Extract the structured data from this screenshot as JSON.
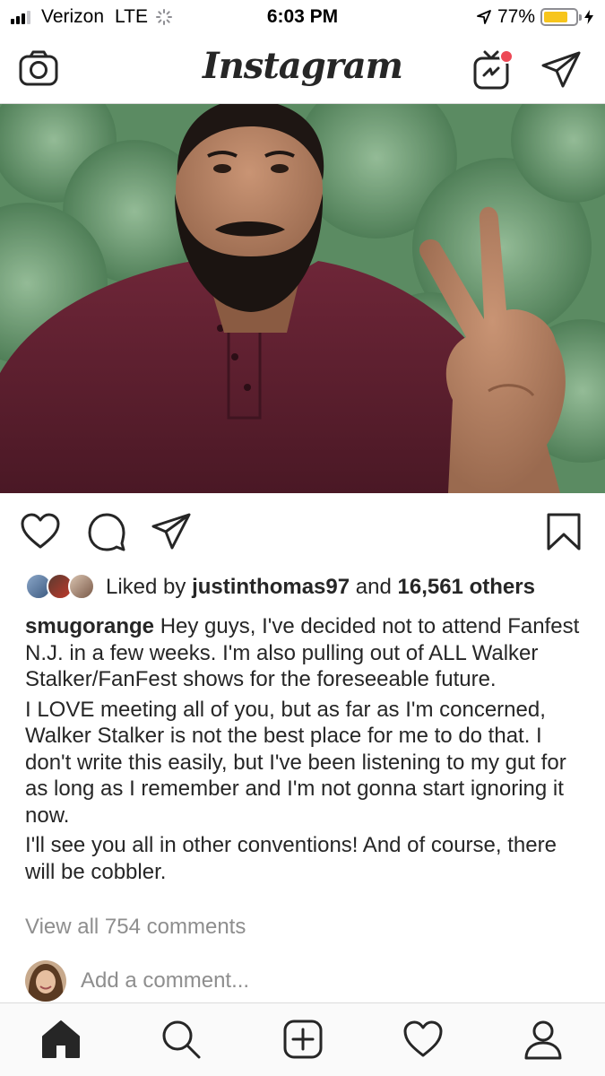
{
  "status_bar": {
    "carrier": "Verizon",
    "network": "LTE",
    "time": "6:03 PM",
    "battery_percent": "77%",
    "battery_level": 0.77,
    "battery_color": "#f7c51c"
  },
  "header": {
    "logo": "Instagram",
    "igtv_badge_color": "#ed4956"
  },
  "post": {
    "liked_by_prefix": "Liked by",
    "liked_by_user": "justinthomas97",
    "liked_by_conjunction": "and",
    "liked_by_others": "16,561 others",
    "caption_username": "smugorange",
    "caption_paragraphs": [
      "Hey guys, I've decided not to attend Fanfest N.J. in a few weeks. I'm also pulling out of ALL Walker Stalker/FanFest shows for the foreseeable future.",
      "I LOVE meeting all of you, but as far as I'm concerned, Walker Stalker is not the best place for me to do that. I don't write this easily, but I've been listening to my gut for as long as I remember and I'm not gonna start ignoring it now.",
      "I'll see you all in other conventions! And of course, there will be cobbler."
    ],
    "view_comments": "View all 754 comments",
    "add_comment_placeholder": "Add a comment..."
  },
  "icons": {
    "header": [
      "camera-icon",
      "igtv-icon",
      "direct-message-icon"
    ],
    "actions": [
      "heart-icon",
      "comment-icon",
      "share-icon",
      "bookmark-icon"
    ],
    "tabs": [
      "home-icon",
      "search-icon",
      "add-post-icon",
      "activity-heart-icon",
      "profile-icon"
    ]
  }
}
